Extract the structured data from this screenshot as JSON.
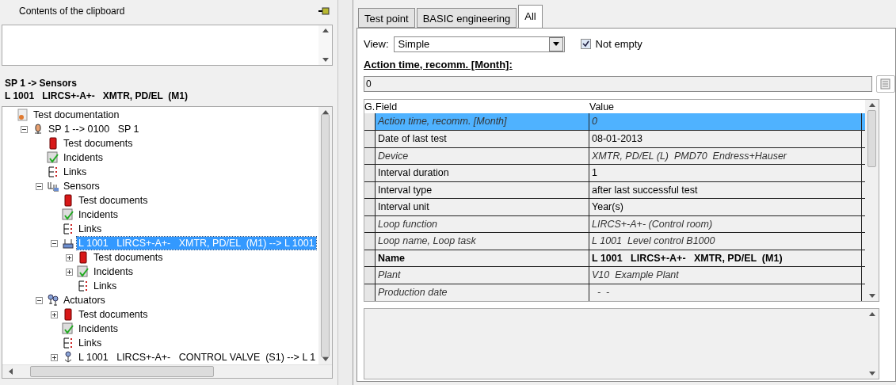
{
  "clipboard": {
    "title": "Contents of the clipboard"
  },
  "path": {
    "line_1": "SP 1 -> Sensors",
    "line_2": "L 1001   LIRCS+-A+-   XMTR, PD/EL  (M1)"
  },
  "tree": [
    {
      "label": "Test documentation",
      "kind": "root",
      "selected": false,
      "children": [
        {
          "label": "SP 1 --> 0100   SP 1",
          "kind": "station",
          "expanded": true,
          "selected": false,
          "children": [
            {
              "label": "Test documents",
              "kind": "document",
              "selected": false
            },
            {
              "label": "Incidents",
              "kind": "incident",
              "selected": false
            },
            {
              "label": "Links",
              "kind": "link",
              "selected": false
            },
            {
              "label": "Sensors",
              "kind": "sensors",
              "expanded": true,
              "selected": false,
              "children": [
                {
                  "label": "Test documents",
                  "kind": "document",
                  "selected": false
                },
                {
                  "label": "Incidents",
                  "kind": "incident",
                  "selected": false
                },
                {
                  "label": "Links",
                  "kind": "link",
                  "selected": false
                },
                {
                  "label": "L 1001   LIRCS+-A+-   XMTR, PD/EL  (M1) --> L 1001",
                  "kind": "sensor",
                  "expanded": true,
                  "selected": true,
                  "children": [
                    {
                      "label": "Test documents",
                      "kind": "document",
                      "expanded": false,
                      "selected": false
                    },
                    {
                      "label": "Incidents",
                      "kind": "incident",
                      "expanded": false,
                      "selected": false
                    },
                    {
                      "label": "Links",
                      "kind": "link",
                      "selected": false
                    }
                  ]
                }
              ]
            },
            {
              "label": "Actuators",
              "kind": "actuators",
              "expanded": true,
              "selected": false,
              "children": [
                {
                  "label": "Test documents",
                  "kind": "document",
                  "expanded": false,
                  "selected": false
                },
                {
                  "label": "Incidents",
                  "kind": "incident",
                  "selected": false
                },
                {
                  "label": "Links",
                  "kind": "link",
                  "selected": false
                },
                {
                  "label": "L 1001   LIRCS+-A+-   CONTROL VALVE  (S1) --> L 1",
                  "kind": "valve",
                  "expanded": false,
                  "selected": false
                }
              ]
            }
          ]
        }
      ]
    }
  ],
  "tabs": [
    {
      "label": "Test point",
      "selected": false
    },
    {
      "label": "BASIC engineering",
      "selected": false
    },
    {
      "label": "All",
      "selected": true
    }
  ],
  "view": {
    "label": "View:",
    "value": "Simple"
  },
  "not_empty": {
    "label": "Not empty",
    "checked": true
  },
  "detail": {
    "label": "Action time, recomm. [Month]:",
    "value": "0"
  },
  "table": {
    "columns": [
      "G.",
      "Field",
      "Value"
    ],
    "rows": [
      {
        "field": "Action time, recomm. [Month]",
        "value": "0",
        "kind": "derived",
        "selected": true
      },
      {
        "field": "Date of last test",
        "value": "08-01-2013",
        "kind": "editable",
        "selected": false
      },
      {
        "field": "Device",
        "value": "XMTR, PD/EL (L)  PMD70  Endress+Hauser",
        "kind": "derived",
        "selected": false
      },
      {
        "field": "Interval duration",
        "value": "1",
        "kind": "editable",
        "selected": false
      },
      {
        "field": "Interval type",
        "value": "after last successful test",
        "kind": "editable",
        "selected": false
      },
      {
        "field": "Interval unit",
        "value": "Year(s)",
        "kind": "editable",
        "selected": false
      },
      {
        "field": "Loop function",
        "value": "LIRCS+-A+- (Control room)",
        "kind": "derived",
        "selected": false
      },
      {
        "field": "Loop name, Loop task",
        "value": "L 1001  Level control B1000",
        "kind": "derived",
        "selected": false
      },
      {
        "field": "Name",
        "value": "L 1001   LIRCS+-A+-   XMTR, PD/EL  (M1)",
        "kind": "key",
        "selected": false
      },
      {
        "field": "Plant",
        "value": "V10  Example Plant",
        "kind": "derived",
        "selected": false
      },
      {
        "field": "Production date",
        "value": "  -  -",
        "kind": "derived",
        "selected": false
      }
    ]
  }
}
